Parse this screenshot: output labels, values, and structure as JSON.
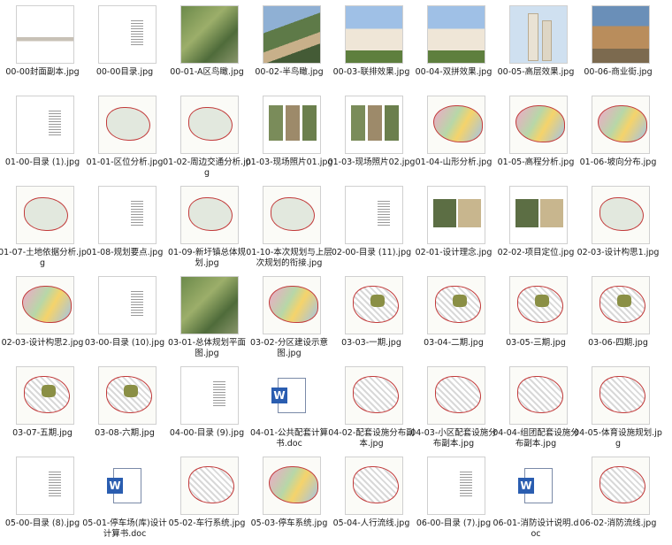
{
  "files": [
    {
      "label": "00-00封面副本.jpg",
      "kind": "cover"
    },
    {
      "label": "00-00目录.jpg",
      "kind": "toc"
    },
    {
      "label": "00-01-A区鸟瞰.jpg",
      "kind": "aerial1"
    },
    {
      "label": "00-02-半鸟瞰.jpg",
      "kind": "aerial2"
    },
    {
      "label": "00-03-联排效果.jpg",
      "kind": "villa"
    },
    {
      "label": "00-04-双拼效果.jpg",
      "kind": "villa"
    },
    {
      "label": "00-05-高层效果.jpg",
      "kind": "tower"
    },
    {
      "label": "00-06-商业街.jpg",
      "kind": "street"
    },
    {
      "label": "01-00-目录 (1).jpg",
      "kind": "toc"
    },
    {
      "label": "01-01-区位分析.jpg",
      "kind": "map"
    },
    {
      "label": "01-02-周边交通分析.jpg",
      "kind": "map"
    },
    {
      "label": "01-03-现场照片01.jpg",
      "kind": "photos"
    },
    {
      "label": "01-03-现场照片02.jpg",
      "kind": "photos"
    },
    {
      "label": "01-04-山形分析.jpg",
      "kind": "mapcolor"
    },
    {
      "label": "01-05-高程分析.jpg",
      "kind": "mapcolor"
    },
    {
      "label": "01-06-坡向分布.jpg",
      "kind": "mapcolor"
    },
    {
      "label": "01-07-土地依据分析.jpg",
      "kind": "map"
    },
    {
      "label": "01-08-规划要点.jpg",
      "kind": "toc"
    },
    {
      "label": "01-09-新圩镇总体规划.jpg",
      "kind": "map"
    },
    {
      "label": "01-10-本次规划与上层次规划的衔接.jpg",
      "kind": "map"
    },
    {
      "label": "02-00-目录 (11).jpg",
      "kind": "toc"
    },
    {
      "label": "02-01-设计理念.jpg",
      "kind": "concept"
    },
    {
      "label": "02-02-项目定位.jpg",
      "kind": "concept"
    },
    {
      "label": "02-03-设计构思1.jpg",
      "kind": "map"
    },
    {
      "label": "02-03-设计构思2.jpg",
      "kind": "mapcolor"
    },
    {
      "label": "03-00-目录 (10).jpg",
      "kind": "toc"
    },
    {
      "label": "03-01-总体规划平面图.jpg",
      "kind": "aerial1"
    },
    {
      "label": "03-02-分区建设示意图.jpg",
      "kind": "mapcolor"
    },
    {
      "label": "03-03-一期.jpg",
      "kind": "maplayout-hl"
    },
    {
      "label": "03-04-二期.jpg",
      "kind": "maplayout-hl"
    },
    {
      "label": "03-05-三期.jpg",
      "kind": "maplayout-hl"
    },
    {
      "label": "03-06-四期.jpg",
      "kind": "maplayout-hl"
    },
    {
      "label": "03-07-五期.jpg",
      "kind": "maplayout-hl"
    },
    {
      "label": "03-08-六期.jpg",
      "kind": "maplayout-hl"
    },
    {
      "label": "04-00-目录 (9).jpg",
      "kind": "toc"
    },
    {
      "label": "04-01-公共配套计算书.doc",
      "kind": "doc"
    },
    {
      "label": "04-02-配套设施分布副本.jpg",
      "kind": "maplayout"
    },
    {
      "label": "04-03-小区配套设施分布副本.jpg",
      "kind": "maplayout"
    },
    {
      "label": "04-04-组团配套设施分布副本.jpg",
      "kind": "maplayout"
    },
    {
      "label": "04-05-体育设施规划.jpg",
      "kind": "maplayout"
    },
    {
      "label": "05-00-目录 (8).jpg",
      "kind": "toc"
    },
    {
      "label": "05-01-停车场(库)设计计算书.doc",
      "kind": "doc"
    },
    {
      "label": "05-02-车行系统.jpg",
      "kind": "maplayout"
    },
    {
      "label": "05-03-停车系统.jpg",
      "kind": "mapcolor"
    },
    {
      "label": "05-04-人行流线.jpg",
      "kind": "maplayout"
    },
    {
      "label": "06-00-目录 (7).jpg",
      "kind": "toc"
    },
    {
      "label": "06-01-消防设计说明.doc",
      "kind": "doc"
    },
    {
      "label": "06-02-消防流线.jpg",
      "kind": "maplayout"
    }
  ]
}
